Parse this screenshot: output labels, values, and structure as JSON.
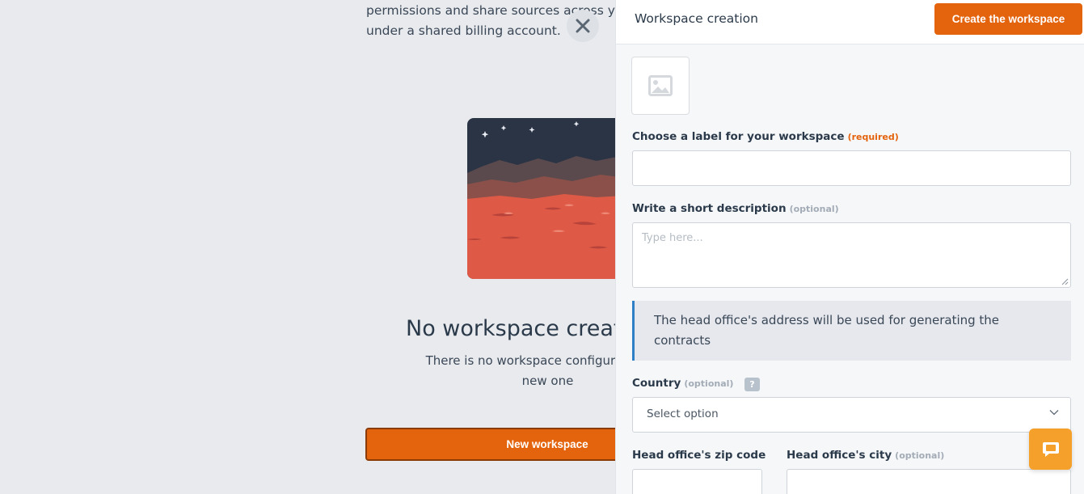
{
  "background": {
    "intro_line1": "permissions and share sources across yo",
    "intro_line2": "under a shared billing account.",
    "empty_title": "No workspace creat",
    "empty_desc_line1": "There is no workspace configured for no",
    "empty_desc_line2": "new one",
    "new_workspace_label": "New workspace"
  },
  "drawer": {
    "title": "Workspace creation",
    "create_label": "Create the workspace",
    "label_field": {
      "label": "Choose a label for your workspace",
      "tag": "(required)",
      "value": ""
    },
    "description_field": {
      "label": "Write a short description",
      "tag": "(optional)",
      "placeholder": "Type here..."
    },
    "info_text": "The head office's address will be used for generating the contracts",
    "country_field": {
      "label": "Country",
      "tag": "(optional)",
      "help": "?",
      "value": "Select option"
    },
    "zip_field": {
      "label": "Head office's zip code"
    },
    "city_field": {
      "label": "Head office's city",
      "tag": "(optional)"
    }
  },
  "icons": {
    "close": "close-icon",
    "image_placeholder": "image-placeholder-icon",
    "chevron": "chevron-down-icon",
    "chat": "chat-icon",
    "resize": "resize-grip-icon"
  },
  "colors": {
    "accent": "#e4630d",
    "info_border": "#2f7fc6",
    "chat": "#f5a02a"
  }
}
